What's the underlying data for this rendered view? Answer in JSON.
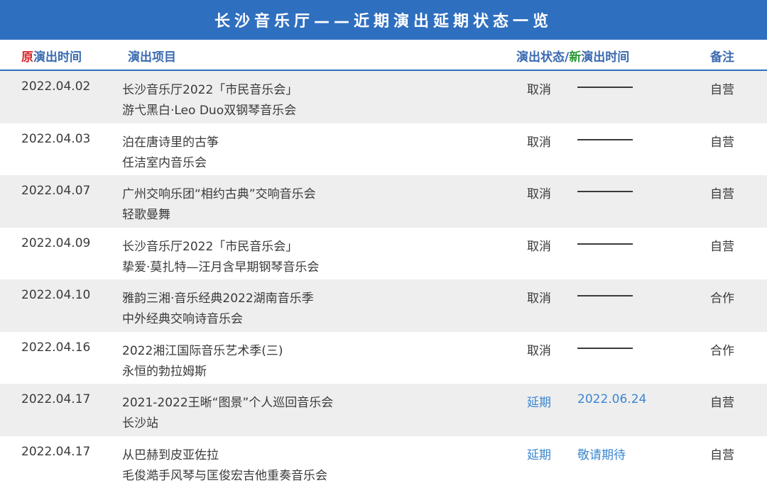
{
  "title": "长沙音乐厅——近期演出延期状态一览",
  "header": {
    "col_date_prefix": "原",
    "col_date_rest": "演出时间",
    "col_program": "演出项目",
    "col_status": "演出状态/",
    "col_new_prefix": "新",
    "col_new_rest": "演出时间",
    "col_note": "备注"
  },
  "rows": [
    {
      "date": "2022.04.02",
      "line1": "长沙音乐厅2022「市民音乐会」",
      "line2": "游弋黑白·Leo Duo双钢琴音乐会",
      "status": "取消",
      "new_time": "",
      "note": "自营",
      "highlight": false
    },
    {
      "date": "2022.04.03",
      "line1": "泊在唐诗里的古筝",
      "line2": "任洁室内音乐会",
      "status": "取消",
      "new_time": "",
      "note": "自营",
      "highlight": false
    },
    {
      "date": "2022.04.07",
      "line1": "广州交响乐团“相约古典”交响音乐会",
      "line2": "轻歌曼舞",
      "status": "取消",
      "new_time": "",
      "note": "自营",
      "highlight": false
    },
    {
      "date": "2022.04.09",
      "line1": "长沙音乐厅2022「市民音乐会」",
      "line2": "挚爱·莫扎特—汪月含早期钢琴音乐会",
      "status": "取消",
      "new_time": "",
      "note": "自营",
      "highlight": false
    },
    {
      "date": "2022.04.10",
      "line1": "雅韵三湘·音乐经典2022湖南音乐季",
      "line2": "中外经典交响诗音乐会",
      "status": "取消",
      "new_time": "",
      "note": "合作",
      "highlight": false
    },
    {
      "date": "2022.04.16",
      "line1": "2022湘江国际音乐艺术季(三)",
      "line2": "永恒的勃拉姆斯",
      "status": "取消",
      "new_time": "",
      "note": "合作",
      "highlight": false
    },
    {
      "date": "2022.04.17",
      "line1": "2021-2022王晰“图景”个人巡回音乐会",
      "line2": "长沙站",
      "status": "延期",
      "new_time": "2022.06.24",
      "note": "自营",
      "highlight": true
    },
    {
      "date": "2022.04.17",
      "line1": "从巴赫到皮亚佐拉",
      "line2": "毛俊澔手风琴与匡俊宏吉他重奏音乐会",
      "status": "延期",
      "new_time": "敬请期待",
      "note": "自营",
      "highlight": true
    }
  ]
}
